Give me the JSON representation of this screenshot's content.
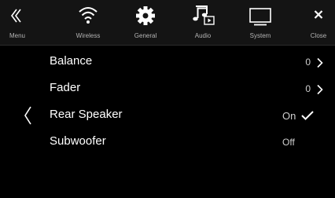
{
  "tabs": [
    {
      "label": "Menu",
      "icon": "menu-double-chevron-icon"
    },
    {
      "label": "Wireless",
      "icon": "wifi-icon"
    },
    {
      "label": "General",
      "icon": "gear-icon"
    },
    {
      "label": "Audio",
      "icon": "music-note-icon"
    },
    {
      "label": "System",
      "icon": "monitor-icon"
    },
    {
      "label": "Close",
      "icon": "close-icon"
    }
  ],
  "settings": [
    {
      "label": "Balance",
      "value": "0"
    },
    {
      "label": "Fader",
      "value": "0"
    },
    {
      "label": "Rear Speaker",
      "value": "On"
    },
    {
      "label": "Subwoofer",
      "value": "Off"
    }
  ],
  "colors": {
    "background": "#000000",
    "topbar": "#141414",
    "text": "#ffffff",
    "muted": "#b4b4b4"
  }
}
